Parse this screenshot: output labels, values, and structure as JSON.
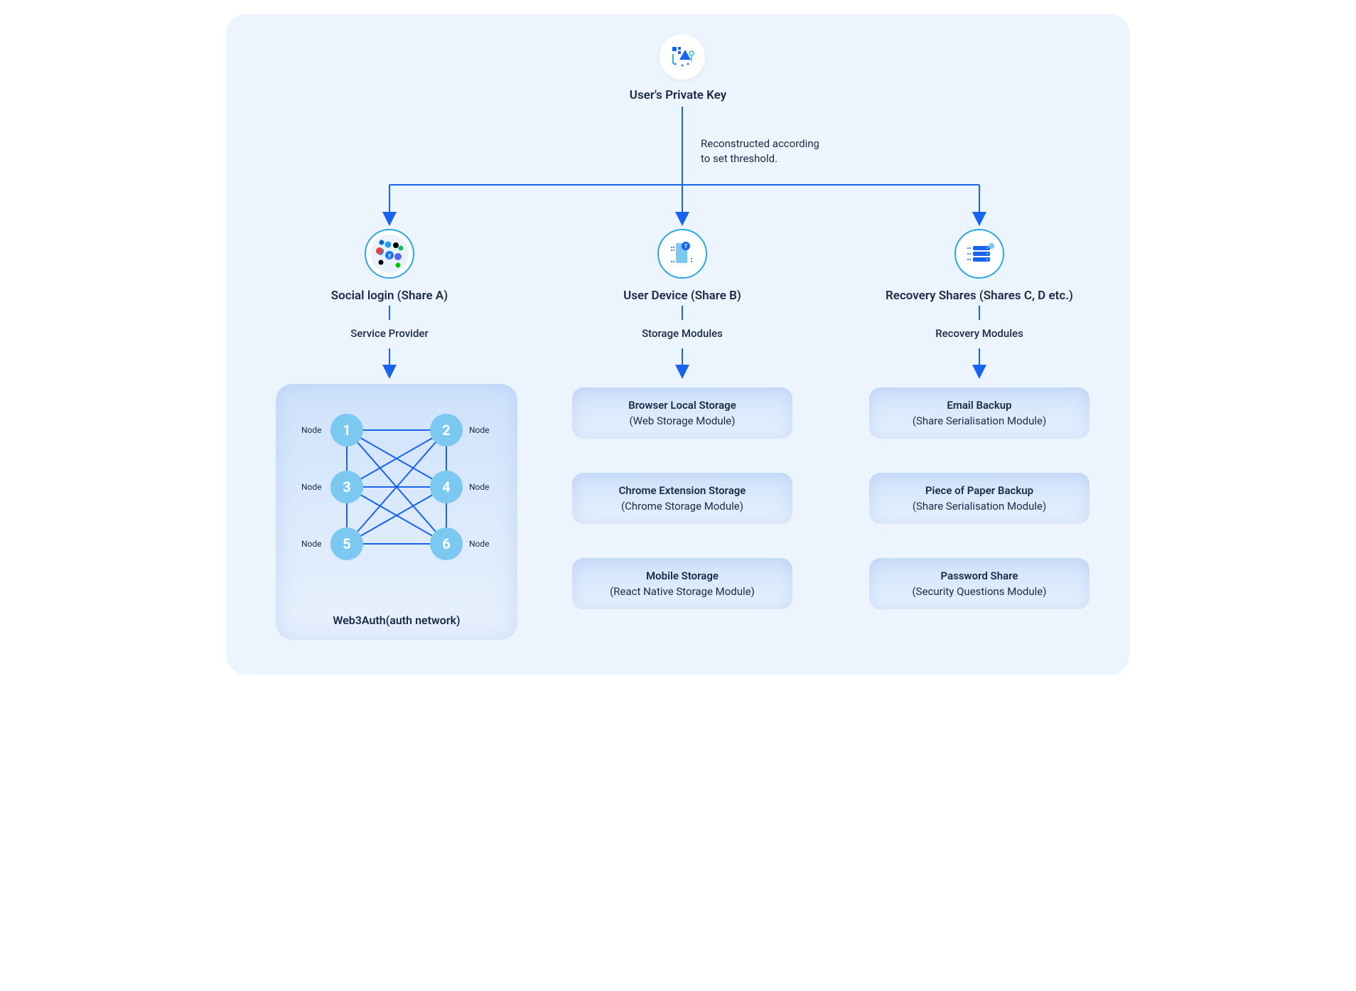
{
  "top": {
    "title": "User's Private  Key"
  },
  "annotation": {
    "line1": "Reconstructed according",
    "line2": "to set threshold."
  },
  "branches": {
    "a": {
      "title": "Social login (Share A)",
      "sub": "Service Provider"
    },
    "b": {
      "title": "User Device (Share B)",
      "sub": "Storage Modules"
    },
    "c": {
      "title": "Recovery Shares (Shares C, D etc.)",
      "sub": "Recovery Modules"
    }
  },
  "network": {
    "title": "Web3Auth(auth network)",
    "node_label": "Node",
    "nodes": [
      "1",
      "2",
      "3",
      "4",
      "5",
      "6"
    ]
  },
  "modules_b": [
    {
      "line1": "Browser Local Storage",
      "line2": "(Web Storage Module)"
    },
    {
      "line1": "Chrome Extension Storage",
      "line2": "(Chrome Storage Module)"
    },
    {
      "line1": "Mobile Storage",
      "line2": "(React Native Storage Module)"
    }
  ],
  "modules_c": [
    {
      "line1": "Email Backup",
      "line2": "(Share Serialisation Module)"
    },
    {
      "line1": "Piece of Paper Backup",
      "line2": "(Share Serialisation Module)"
    },
    {
      "line1": "Password Share",
      "line2": "(Security Questions Module)"
    }
  ]
}
